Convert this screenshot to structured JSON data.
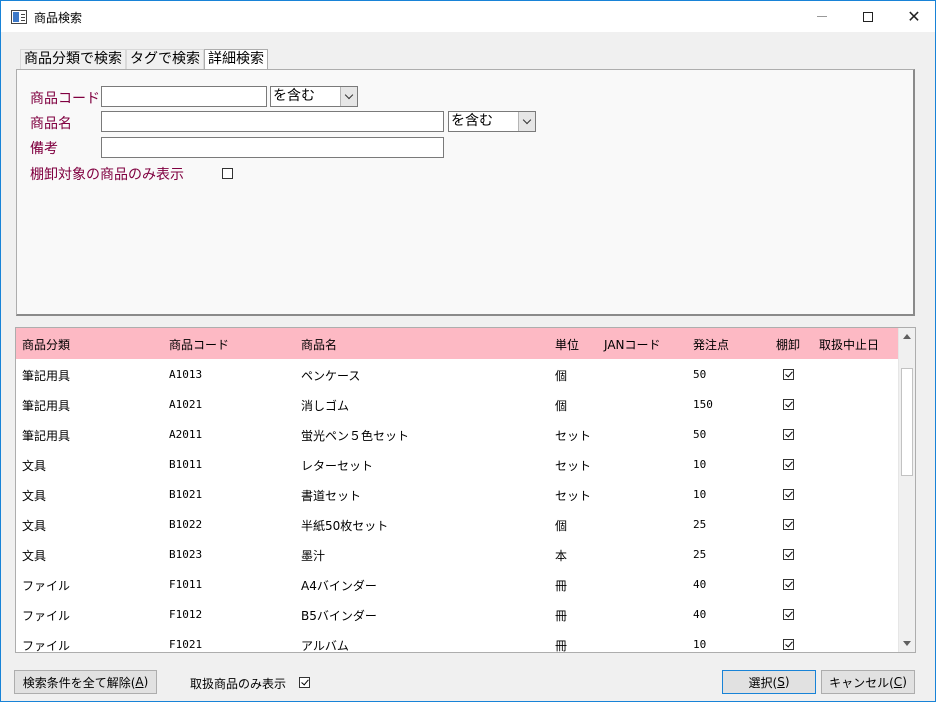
{
  "window": {
    "title": "商品検索"
  },
  "tabs": [
    {
      "label": "商品分類で検索"
    },
    {
      "label": "タグで検索"
    },
    {
      "label": "詳細検索"
    }
  ],
  "search": {
    "code_label": "商品コード",
    "code_value": "",
    "code_match": "を含む",
    "name_label": "商品名",
    "name_value": "",
    "name_match": "を含む",
    "note_label": "備考",
    "note_value": "",
    "stocktake_label": "棚卸対象の商品のみ表示",
    "stocktake_checked": false
  },
  "table": {
    "columns": [
      "商品分類",
      "商品コード",
      "商品名",
      "単位",
      "JANコード",
      "発注点",
      "棚卸",
      "取扱中止日"
    ],
    "rows": [
      {
        "category": "筆記用具",
        "code": "A1013",
        "name": "ペンケース",
        "unit": "個",
        "jan": "",
        "reorder": "50",
        "stocktake": true,
        "discontinued": ""
      },
      {
        "category": "筆記用具",
        "code": "A1021",
        "name": "消しゴム",
        "unit": "個",
        "jan": "",
        "reorder": "150",
        "stocktake": true,
        "discontinued": ""
      },
      {
        "category": "筆記用具",
        "code": "A2011",
        "name": "蛍光ペン５色セット",
        "unit": "セット",
        "jan": "",
        "reorder": "50",
        "stocktake": true,
        "discontinued": ""
      },
      {
        "category": "文具",
        "code": "B1011",
        "name": "レターセット",
        "unit": "セット",
        "jan": "",
        "reorder": "10",
        "stocktake": true,
        "discontinued": ""
      },
      {
        "category": "文具",
        "code": "B1021",
        "name": "書道セット",
        "unit": "セット",
        "jan": "",
        "reorder": "10",
        "stocktake": true,
        "discontinued": ""
      },
      {
        "category": "文具",
        "code": "B1022",
        "name": "半紙50枚セット",
        "unit": "個",
        "jan": "",
        "reorder": "25",
        "stocktake": true,
        "discontinued": ""
      },
      {
        "category": "文具",
        "code": "B1023",
        "name": "墨汁",
        "unit": "本",
        "jan": "",
        "reorder": "25",
        "stocktake": true,
        "discontinued": ""
      },
      {
        "category": "ファイル",
        "code": "F1011",
        "name": "A4バインダー",
        "unit": "冊",
        "jan": "",
        "reorder": "40",
        "stocktake": true,
        "discontinued": ""
      },
      {
        "category": "ファイル",
        "code": "F1012",
        "name": "B5バインダー",
        "unit": "冊",
        "jan": "",
        "reorder": "40",
        "stocktake": true,
        "discontinued": ""
      },
      {
        "category": "ファイル",
        "code": "F1021",
        "name": "アルバム",
        "unit": "冊",
        "jan": "",
        "reorder": "10",
        "stocktake": true,
        "discontinued": ""
      }
    ]
  },
  "bottom": {
    "clear_label": "検索条件を全て解除(",
    "clear_key": "A",
    "clear_suffix": ")",
    "active_only_label": "取扱商品のみ表示",
    "active_only_checked": true,
    "select_label": "選択(",
    "select_key": "S",
    "select_suffix": ")",
    "cancel_label": "キャンセル(",
    "cancel_key": "C",
    "cancel_suffix": ")"
  },
  "colors": {
    "header_bg": "#fdb9c4",
    "label_color": "#800040",
    "accent": "#1883d7"
  }
}
